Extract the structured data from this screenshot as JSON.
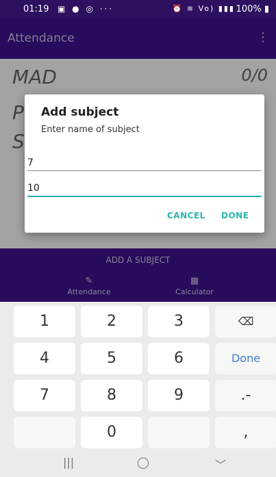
{
  "status": {
    "time": "01:19",
    "left_icons": "▣ ● ◎ ···",
    "right_icons": "⏰ ≋ Vo) ▮▮▮",
    "battery": "100% ▮"
  },
  "appbar": {
    "title": "Attendance",
    "menu_icon": "⋮"
  },
  "list": {
    "row1_name": "MAD",
    "row1_count": "0/0",
    "row2_letter": "P",
    "row3_letter": "S"
  },
  "bottomnav": {
    "add_subject": "ADD A SUBJECT",
    "nav_attendance": "Attendance",
    "nav_calculator": "Calculator",
    "attendance_icon": "✎",
    "calculator_icon": "▦"
  },
  "dialog": {
    "title": "Add subject",
    "subtitle": "Enter name of subject",
    "field1_value": "7",
    "field2_value": "10",
    "cancel_label": "CANCEL",
    "done_label": "DONE"
  },
  "keyboard": {
    "keys": [
      "1",
      "2",
      "3",
      "⌫",
      "4",
      "5",
      "6",
      "Done",
      "7",
      "8",
      "9",
      ".-",
      "",
      "0",
      "",
      ","
    ]
  },
  "navbar": {
    "recent": "|||",
    "home": "◯",
    "back": "﹀"
  }
}
